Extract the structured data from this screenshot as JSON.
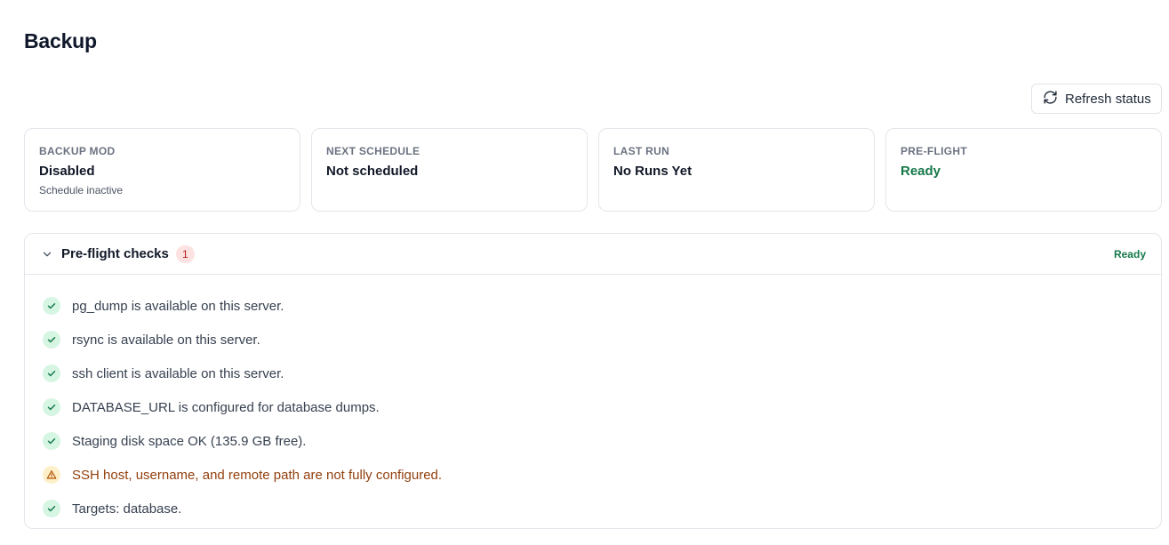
{
  "page": {
    "title": "Backup"
  },
  "toolbar": {
    "refresh_label": "Refresh status",
    "refresh_icon": "refresh-icon"
  },
  "cards": [
    {
      "label": "BACKUP MOD",
      "value": "Disabled",
      "sub": "Schedule inactive"
    },
    {
      "label": "NEXT SCHEDULE",
      "value": "Not scheduled",
      "sub": ""
    },
    {
      "label": "LAST RUN",
      "value": "No Runs Yet",
      "sub": ""
    },
    {
      "label": "PRE-FLIGHT",
      "value": "Ready",
      "sub": ""
    }
  ],
  "preflight": {
    "title": "Pre-flight checks",
    "count": "1",
    "status": "Ready",
    "checks": [
      {
        "text": "pg_dump is available on this server.",
        "state": "ok",
        "icon": "check-icon"
      },
      {
        "text": "rsync is available on this server.",
        "state": "ok",
        "icon": "check-icon"
      },
      {
        "text": "ssh client is available on this server.",
        "state": "ok",
        "icon": "check-icon"
      },
      {
        "text": "DATABASE_URL is configured for database dumps.",
        "state": "ok",
        "icon": "check-icon"
      },
      {
        "text": "Staging disk space OK (135.9 GB free).",
        "state": "ok",
        "icon": "check-icon"
      },
      {
        "text": "SSH host, username, and remote path are not fully configured.",
        "state": "warn",
        "icon": "warning-icon"
      },
      {
        "text": "Targets: database.",
        "state": "ok",
        "icon": "check-icon"
      }
    ]
  },
  "colors": {
    "ready": "#16794a",
    "warning_text": "#92400e",
    "badge_bg": "#fde2e2",
    "badge_text": "#b91c1c",
    "ok_icon_bg": "#d6f5e3",
    "warn_icon_bg": "#fdf0c8"
  }
}
